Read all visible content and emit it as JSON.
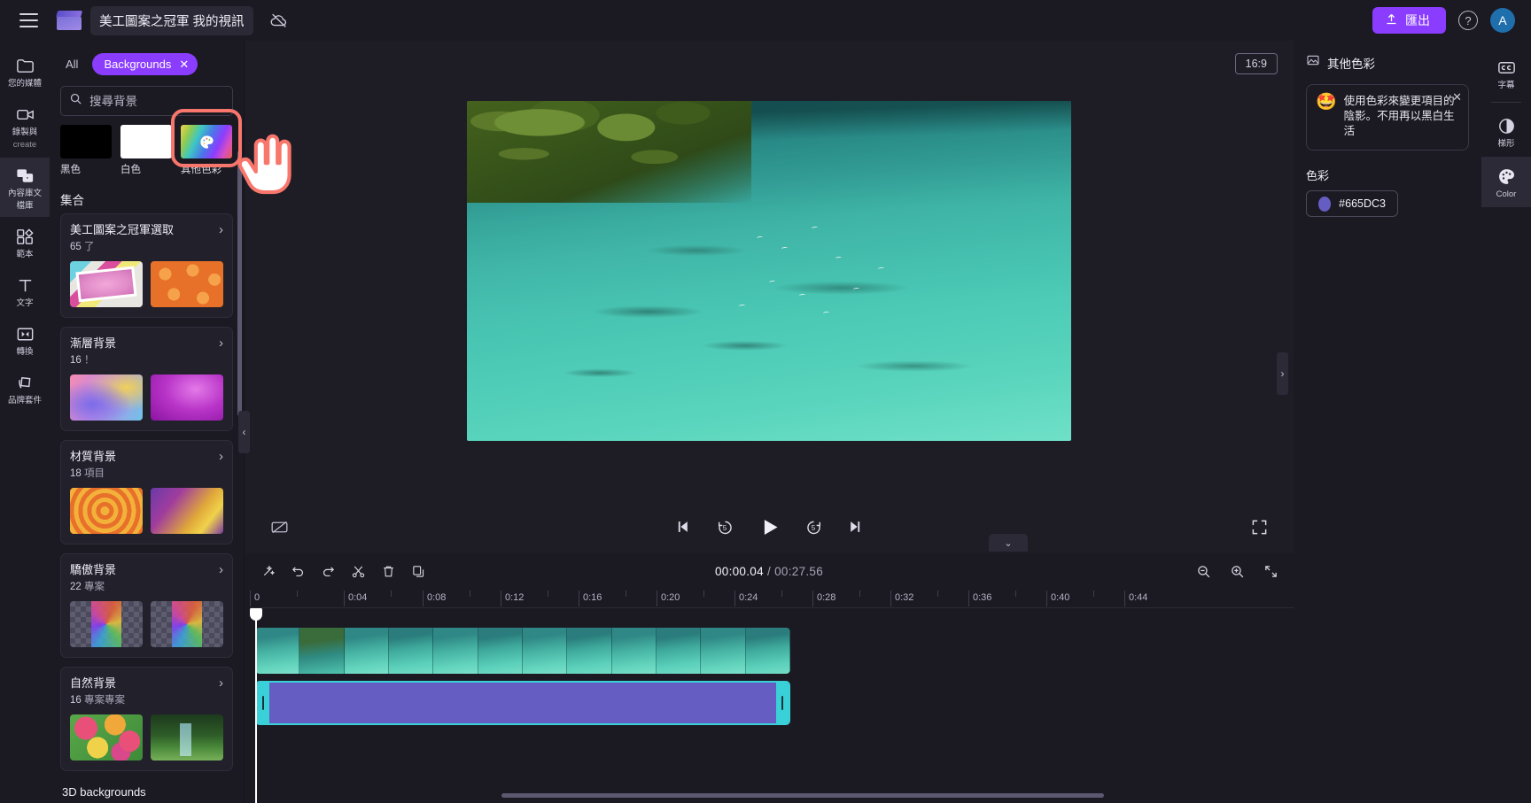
{
  "topbar": {
    "menu_icon": "hamburger-icon",
    "logo_icon": "clipchamp-logo",
    "project_title": "美工圖案之冠軍 我的視訊",
    "cloud_off_icon": "cloud-off-icon",
    "export_label": "匯出",
    "export_icon": "upload-icon",
    "export_color": "#8B3DFF",
    "help_label": "?",
    "avatar_initial": "A"
  },
  "left_rail": {
    "items": [
      {
        "label": "您的媒體",
        "sub": "",
        "icon": "folder-icon",
        "active": false
      },
      {
        "label": "錄製與",
        "sub": "create",
        "icon": "video-camera-icon",
        "active": false
      },
      {
        "label": "內容庫文",
        "sub": "檔庫",
        "icon": "content-library-icon",
        "active": true
      },
      {
        "label": "範本",
        "sub": "",
        "icon": "templates-icon",
        "active": false
      },
      {
        "label": "文字",
        "sub": "",
        "icon": "text-icon",
        "active": false
      },
      {
        "label": "轉換",
        "sub": "",
        "icon": "transitions-icon",
        "active": false
      },
      {
        "label": "品牌套件",
        "sub": "",
        "icon": "brand-kit-icon",
        "active": false
      }
    ]
  },
  "panel": {
    "chip_all": "All",
    "chip_backgrounds": "Backgrounds",
    "chip_close": "✕",
    "search_placeholder": "搜尋背景",
    "search_value": "",
    "search_icon": "search-icon",
    "swatches": [
      {
        "label": "黑色",
        "color": "#000000",
        "kind": "solid"
      },
      {
        "label": "白色",
        "color": "#FFFFFF",
        "kind": "solid"
      },
      {
        "label": "其他色彩",
        "color": "rainbow",
        "kind": "rainbow",
        "icon": "palette-icon",
        "highlighted": true
      }
    ],
    "section_title": "集合",
    "collections": [
      {
        "name": "美工圖案之冠軍選取",
        "count": "65",
        "count_unit": "了",
        "chevron": "›",
        "thumbs": [
          "th-comic",
          "th-sun"
        ]
      },
      {
        "name": "漸層背景",
        "count": "16",
        "count_unit": "！",
        "chevron": "›",
        "thumbs": [
          "th-grad1",
          "th-grad2"
        ]
      },
      {
        "name": "材質背景",
        "count": "18",
        "count_unit": "項目",
        "chevron": "›",
        "thumbs": [
          "th-tex1",
          "th-tex2"
        ]
      },
      {
        "name": "驕傲背景",
        "count": "22",
        "count_unit": "專案",
        "chevron": "›",
        "thumbs": [
          "th-pride",
          "th-pride"
        ]
      },
      {
        "name": "自然背景",
        "count": "16",
        "count_unit": "專案專案",
        "chevron": "›",
        "thumbs": [
          "th-flower",
          "th-forest"
        ]
      }
    ],
    "next_collection_partial": "3D backgrounds"
  },
  "stage": {
    "ratio_badge": "16:9",
    "collapse_left": "‹",
    "collapse_right": "›"
  },
  "playbar": {
    "captions_icon": "captions-off-icon",
    "prev_icon": "skip-previous-icon",
    "back5_icon": "rewind-5-icon",
    "back5_label": "5",
    "play_icon": "play-icon",
    "fwd5_icon": "forward-5-icon",
    "fwd5_label": "5",
    "next_icon": "skip-next-icon",
    "fullscreen_icon": "fullscreen-icon"
  },
  "timeline": {
    "tools": [
      {
        "name": "magic-wand-icon",
        "glyph": "✦"
      },
      {
        "name": "undo-icon",
        "glyph": "↶"
      },
      {
        "name": "redo-icon",
        "glyph": "↷"
      },
      {
        "name": "split-icon",
        "glyph": "✂"
      },
      {
        "name": "delete-icon",
        "glyph": "🗑"
      },
      {
        "name": "duplicate-icon",
        "glyph": "⧉"
      }
    ],
    "current_time": "00:00.04",
    "separator": "/",
    "total_time": "00:27.56",
    "zoom_out_icon": "zoom-out-icon",
    "zoom_in_icon": "zoom-in-icon",
    "fit_icon": "fit-to-timeline-icon",
    "ruler_ticks": [
      "0",
      "0:04",
      "0:08",
      "0:12",
      "0:16",
      "0:20",
      "0:24",
      "0:28",
      "0:32",
      "0:36",
      "0:40",
      "0:44"
    ],
    "collapse_glyph": "⌄",
    "clips": [
      {
        "name": "video-clip",
        "type": "video",
        "selected": false
      },
      {
        "name": "color-clip",
        "type": "color",
        "selected": true,
        "color": "#665DC3"
      }
    ]
  },
  "right_panel": {
    "header_icon": "image-icon",
    "header_title": "其他色彩",
    "tip_emoji": "🤩",
    "tip_text": "使用色彩來變更項目的陰影。不用再以黑白生活",
    "tip_close": "✕",
    "color_label": "色彩",
    "color_hex": "#665DC3",
    "color_value": "#665DC3"
  },
  "right_rail": {
    "items": [
      {
        "label": "字幕",
        "icon": "closed-captions-icon",
        "active": false
      },
      {
        "label": "梯形",
        "icon": "fade-icon",
        "active": false
      },
      {
        "label": "Color",
        "icon": "palette-icon",
        "active": true
      }
    ]
  }
}
